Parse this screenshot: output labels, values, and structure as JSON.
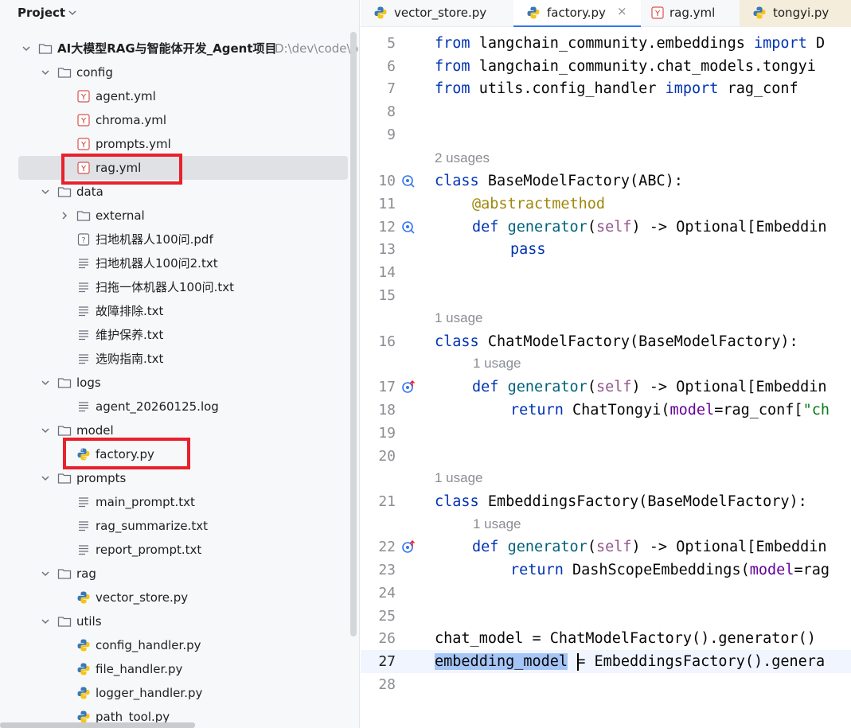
{
  "project_panel": {
    "title": "Project",
    "root": {
      "label": "AI大模型RAG与智能体开发_Agent项目",
      "path_hint": "D:\\dev\\code\\p"
    },
    "folders": {
      "config": "config",
      "data": "data",
      "external": "external",
      "logs": "logs",
      "model": "model",
      "prompts": "prompts",
      "rag": "rag",
      "utils": "utils"
    },
    "files": {
      "agent_yml": "agent.yml",
      "chroma_yml": "chroma.yml",
      "prompts_yml": "prompts.yml",
      "rag_yml": "rag.yml",
      "pdf": "扫地机器人100问.pdf",
      "txt1": "扫地机器人100问2.txt",
      "txt2": "扫拖一体机器人100问.txt",
      "txt3": "故障排除.txt",
      "txt4": "维护保养.txt",
      "txt5": "选购指南.txt",
      "log": "agent_20260125.log",
      "factory_py": "factory.py",
      "main_prompt": "main_prompt.txt",
      "rag_summarize": "rag_summarize.txt",
      "report_prompt": "report_prompt.txt",
      "vector_store": "vector_store.py",
      "config_handler": "config_handler.py",
      "file_handler": "file_handler.py",
      "logger_handler": "logger_handler.py",
      "path_tool": "path_tool.py"
    }
  },
  "tabs": [
    {
      "label": "vector_store.py"
    },
    {
      "label": "factory.py",
      "close": "×"
    },
    {
      "label": "rag.yml"
    },
    {
      "label": "tongyi.py"
    }
  ],
  "editor": {
    "line_numbers": [
      "5",
      "6",
      "7",
      "8",
      "9",
      "10",
      "11",
      "12",
      "13",
      "14",
      "15",
      "16",
      "17",
      "18",
      "19",
      "20",
      "21",
      "22",
      "23",
      "24",
      "25",
      "26",
      "27",
      "28"
    ],
    "usages": {
      "u1": "2 usages",
      "u2": "1 usage",
      "u3": "1 usage",
      "u4": "1 usage",
      "u5": "1 usage"
    },
    "code": {
      "l5_kw": "from",
      "l5_mod": " langchain_community.embeddings ",
      "l5_imp": "import",
      "l5_rest": " D",
      "l6_kw": "from",
      "l6_mod": " langchain_community.chat_models.tongyi",
      "l7_kw": "from",
      "l7_mod": " utils.config_handler ",
      "l7_imp": "import",
      "l7_rest": " rag_conf",
      "l10_kw": "class",
      "l10_rest": " BaseModelFactory(ABC):",
      "l11_dec": "@abstractmethod",
      "l12_kw": "def",
      "l12_fn": "generator",
      "l12_p": "(",
      "l12_self": "self",
      "l12_rest": ") -> Optional[Embeddin",
      "l13_kw": "pass",
      "l16_kw": "class",
      "l16_rest": " ChatModelFactory(BaseModelFactory):",
      "l17_kw": "def",
      "l17_fn": "generator",
      "l17_p": "(",
      "l17_self": "self",
      "l17_rest": ") -> Optional[Embeddin",
      "l18_kw": "return",
      "l18_rest": " ChatTongyi(",
      "l18_arg": "model",
      "l18_eq": "=rag_conf[",
      "l18_str": "\"ch",
      "l21_kw": "class",
      "l21_rest": " EmbeddingsFactory(BaseModelFactory):",
      "l22_kw": "def",
      "l22_fn": "generator",
      "l22_p": "(",
      "l22_self": "self",
      "l22_rest": ") -> Optional[Embeddin",
      "l23_kw": "return",
      "l23_rest": " DashScopeEmbeddings(",
      "l23_arg": "model",
      "l23_eq": "=rag",
      "l26": "chat_model = ChatModelFactory().generator()",
      "l27_sel": "embedding_model",
      "l27_rest": " = EmbeddingsFactory().genera"
    }
  },
  "colors": {
    "highlight_box": "#e8212c",
    "keyword": "#0033b3",
    "function": "#00627a",
    "selection": "#a6c5f7"
  },
  "icons": {
    "folder": "folder-icon",
    "yaml": "yaml-file-icon",
    "python": "python-file-icon",
    "text": "text-file-icon",
    "unknown": "unknown-file-icon",
    "implemented": "implemented-method-icon",
    "override": "override-method-icon"
  }
}
